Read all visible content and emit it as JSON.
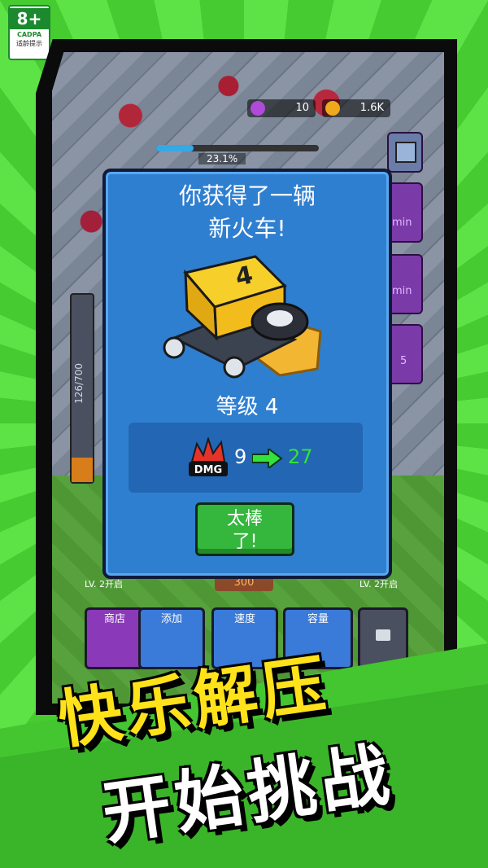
{
  "age_badge": {
    "rating": "8+",
    "org": "CADPA",
    "hint": "适龄提示"
  },
  "hud": {
    "gems": "10",
    "coins": "1.6K",
    "progress_pct": 23.1,
    "progress_label": "23.1%"
  },
  "side_buttons": [
    {
      "label": "min"
    },
    {
      "label": "min"
    },
    {
      "label": "5"
    }
  ],
  "capacity_gauge": {
    "label": "126/700"
  },
  "bottom_bar": {
    "shop": "商店",
    "add": "添加",
    "speed": "速度",
    "capacity": "容量",
    "lv_left": "LV. 2开启",
    "lv_right": "LV. 2开启",
    "cost": "300"
  },
  "dialog": {
    "title_line1": "你获得了一辆",
    "title_line2": "新火车!",
    "train_number": "4",
    "level_label": "等级 4",
    "dmg_icon_text": "DMG",
    "dmg_from": "9",
    "dmg_to": "27",
    "ok_line1": "太棒",
    "ok_line2": "了!"
  },
  "slogan": {
    "line1": "快乐解压",
    "line2": "开始挑战"
  },
  "colors": {
    "accent_green": "#35b63d",
    "dialog_blue": "#2f7fd1",
    "slogan_yellow": "#ffe21a"
  }
}
